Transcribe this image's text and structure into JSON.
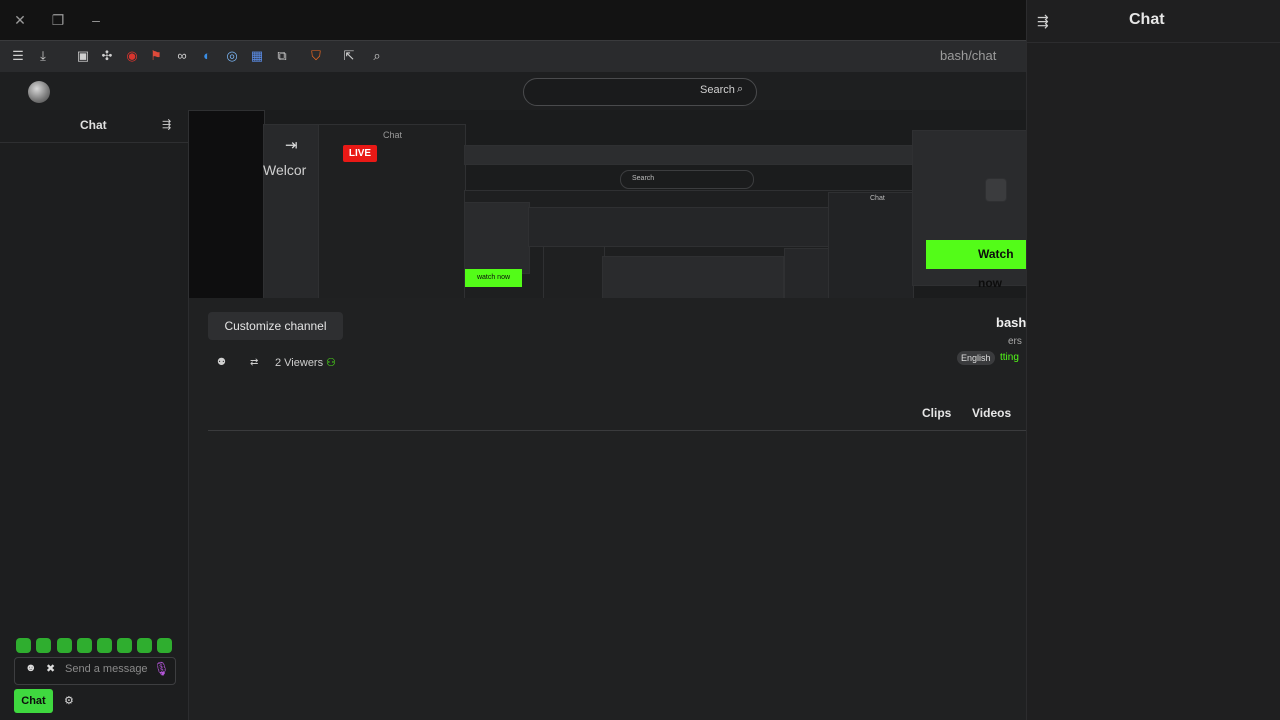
{
  "browser": {
    "url": "bash/chat",
    "window_controls": [
      "close",
      "restore",
      "minimize"
    ]
  },
  "page": {
    "search_label": "Search",
    "left_chat": {
      "title": "Chat",
      "message_placeholder": "Send a message",
      "chat_button": "Chat"
    },
    "stream": {
      "live_badge": "LIVE",
      "welcome_text": "Welcor",
      "inner_chat_label": "Chat",
      "inner_search_label": "Search",
      "inner_chat2_label": "Chat",
      "watch_now_label": "Watch now",
      "watch_now_small": "watch now"
    },
    "channel": {
      "customize_label": "Customize channel",
      "name": "bash",
      "viewers_subtitle": "ers",
      "tag": "English",
      "category": "tting",
      "viewers_count": "2 Viewers"
    },
    "tabs": {
      "videos": "Videos",
      "clips": "Clips"
    }
  },
  "right_chat": {
    "title": "Chat"
  },
  "colors": {
    "accent": "#53fc18",
    "live": "#e91916",
    "background": "#202122"
  }
}
